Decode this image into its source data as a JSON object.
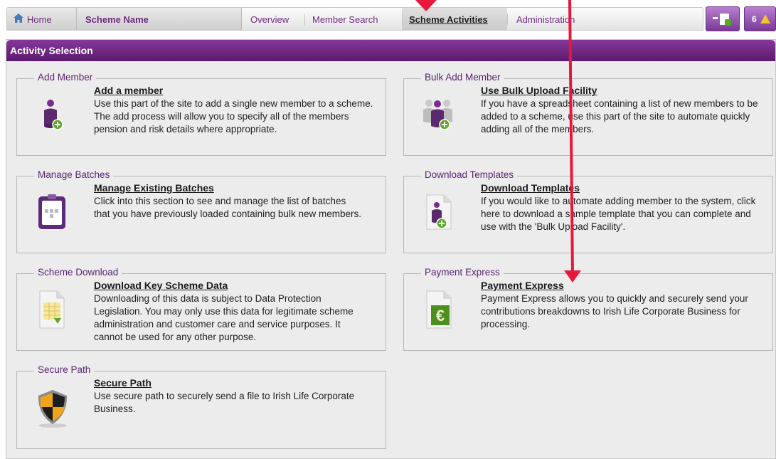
{
  "nav": {
    "home": "Home",
    "scheme_name": "Scheme Name",
    "tabs": [
      {
        "label": "Overview"
      },
      {
        "label": "Member Search"
      },
      {
        "label": "Scheme Activities"
      },
      {
        "label": "Administration"
      }
    ],
    "notification_count": "6"
  },
  "panel": {
    "title": "Activity Selection"
  },
  "activities": [
    {
      "legend": "Add Member",
      "link": "Add a member",
      "description": "Use this part of the site to add a single new member to a scheme. The add process will allow you to specify all of the members pension and risk details where appropriate.",
      "icon": "person-add-icon"
    },
    {
      "legend": "Bulk Add Member",
      "link": "Use Bulk Upload Facility",
      "description": "If you have a spreadsheet containing a list of new members to be added to a scheme, use this part of the site to automate quickly adding all of the members.",
      "icon": "group-add-icon"
    },
    {
      "legend": "Manage Batches",
      "link": "Manage Existing Batches",
      "description": "Click into this section to see and manage the list of batches that you have previously loaded containing bulk new members.",
      "icon": "clipboard-icon"
    },
    {
      "legend": "Download Templates",
      "link": "Download Templates",
      "description": "If you would like to automate adding member to the system, click here to download a sample template that you can complete and use with the 'Bulk Upload Facility'.",
      "icon": "template-download-icon"
    },
    {
      "legend": "Scheme Download",
      "link": "Download Key Scheme Data",
      "description": "Downloading of this data is subject to Data Protection Legislation. You may only use this data for legitimate scheme administration and customer care and service purposes. It cannot be used for any other purpose.",
      "icon": "spreadsheet-download-icon"
    },
    {
      "legend": "Payment Express",
      "link": "Payment Express",
      "description": "Payment Express allows you to quickly and securely send your contributions breakdowns to Irish Life Corporate Business for processing.",
      "icon": "euro-document-icon"
    },
    {
      "legend": "Secure Path",
      "link": "Secure Path",
      "description": "Use secure path to securely send a file to Irish Life Corporate Business.",
      "icon": "shield-icon"
    }
  ],
  "colors": {
    "brand_purple": "#6e2c7e",
    "header_purple": "#5a1b6d",
    "annotation_red": "#e8183c"
  }
}
